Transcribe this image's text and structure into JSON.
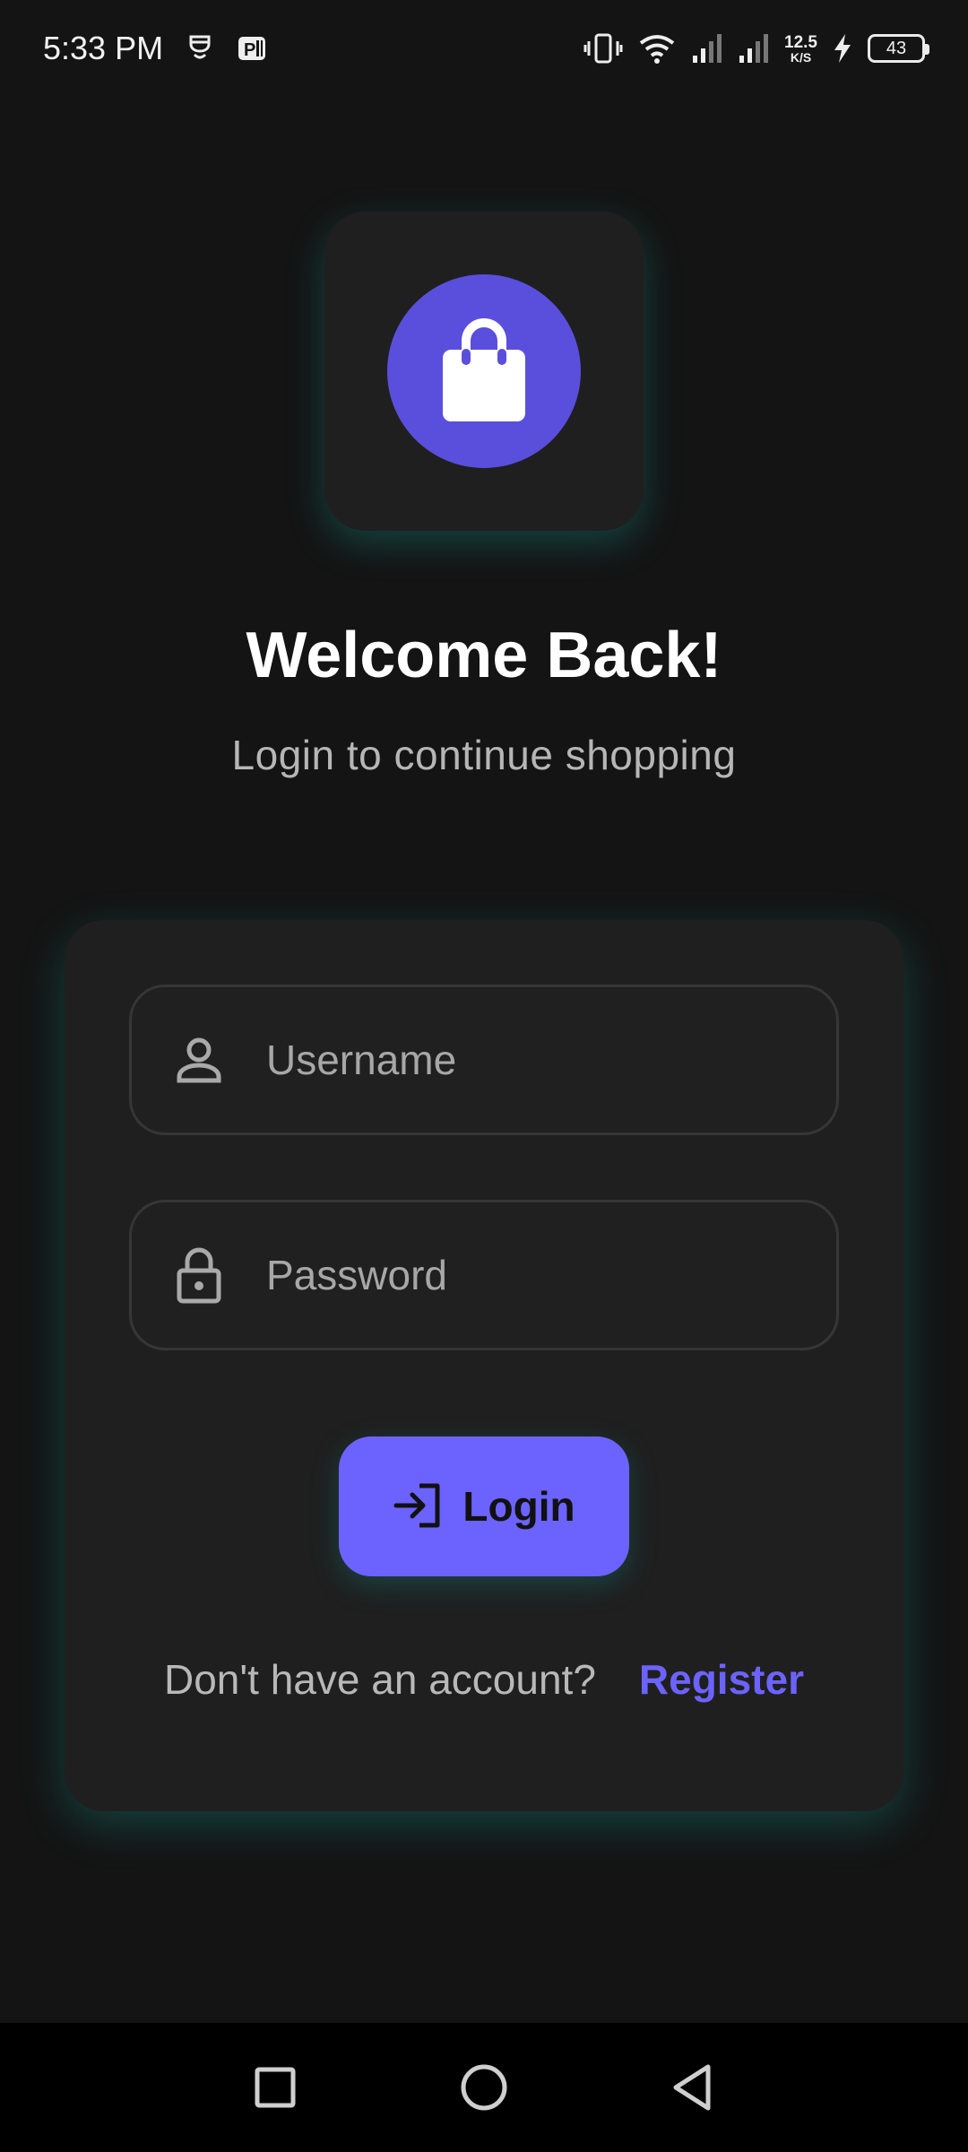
{
  "status_bar": {
    "time": "5:33 PM",
    "net_speed_value": "12.5",
    "net_speed_unit": "K/S",
    "battery_level": "43"
  },
  "logo": {
    "icon": "shopping-bag-icon",
    "accent_color": "#5a4fdc"
  },
  "header": {
    "title": "Welcome Back!",
    "subtitle": "Login to continue shopping"
  },
  "form": {
    "username": {
      "placeholder": "Username",
      "value": "",
      "icon": "person-icon"
    },
    "password": {
      "placeholder": "Password",
      "value": "",
      "icon": "lock-icon"
    },
    "login_label": "Login",
    "login_icon": "login-icon",
    "register_prompt": "Don't have an account?",
    "register_link": "Register",
    "button_color": "#6c63ff"
  },
  "nav_bar": {
    "recents": "square-icon",
    "home": "circle-icon",
    "back": "triangle-back-icon"
  }
}
